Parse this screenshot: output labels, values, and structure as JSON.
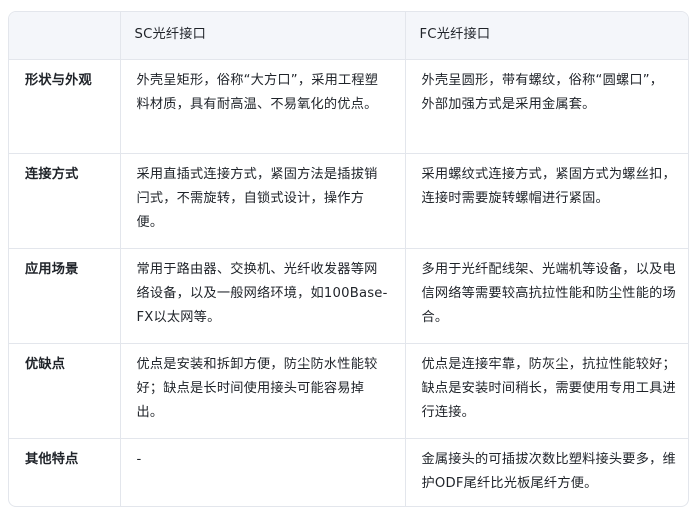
{
  "header": {
    "col1": "",
    "col2": "SC光纤接口",
    "col3": "FC光纤接口"
  },
  "rows": [
    {
      "label": "形状与外观",
      "sc": "外壳呈矩形，俗称“大方口”，采用工程塑料材质，具有耐高温、不易氧化的优点。",
      "fc": "外壳呈圆形，带有螺纹，俗称“圆螺口”，外部加强方式是采用金属套。"
    },
    {
      "label": "连接方式",
      "sc": "采用直插式连接方式，紧固方法是插拔销闩式，不需旋转，自锁式设计，操作方便。",
      "fc": "采用螺纹式连接方式，紧固方式为螺丝扣，连接时需要旋转螺帽进行紧固。"
    },
    {
      "label": "应用场景",
      "sc": "常用于路由器、交换机、光纤收发器等网络设备，以及一般网络环境，如100Base-FX以太网等。",
      "fc": "多用于光纤配线架、光端机等设备，以及电信网络等需要较高抗拉性能和防尘性能的场合。"
    },
    {
      "label": "优缺点",
      "sc": "优点是安装和拆卸方便，防尘防水性能较好；缺点是长时间使用接头可能容易掉出。",
      "fc": "优点是连接牢靠，防灰尘，抗拉性能较好；缺点是安装时间稍长，需要使用专用工具进行连接。"
    },
    {
      "label": "其他特点",
      "sc": "-",
      "fc": "金属接头的可插拔次数比塑料接头要多，维护ODF尾纤比光板尾纤方便。"
    }
  ]
}
